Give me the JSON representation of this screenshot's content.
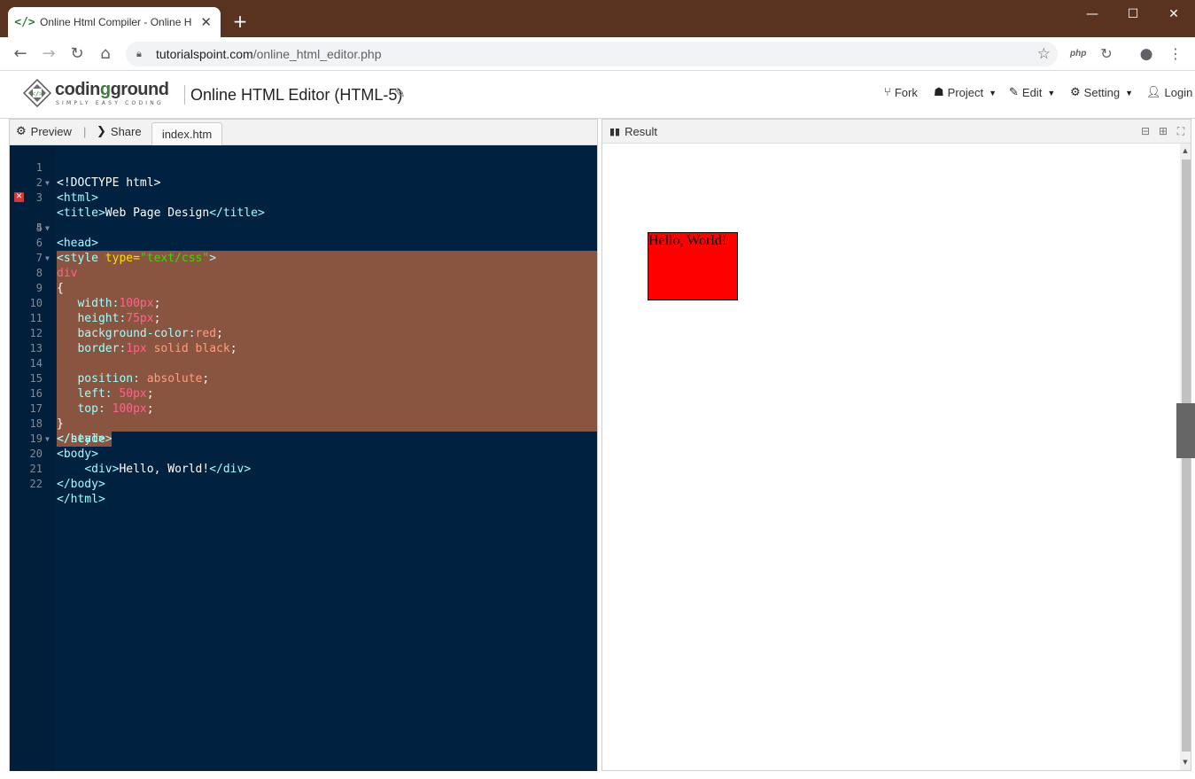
{
  "browser": {
    "tab_title": "Online Html Compiler - Online H",
    "tab_close": "✕",
    "new_tab": "+",
    "url_host": "tutorialspoint.com",
    "url_path": "/online_html_editor.php",
    "ext_php": "php",
    "win_min": "—",
    "win_max": "☐",
    "win_close": "✕"
  },
  "header": {
    "logo_main": "codin",
    "logo_green": "g",
    "logo_rest": "ground",
    "logo_tagline": "SIMPLY EASY CODING",
    "title": "Online HTML Editor (HTML-5)",
    "menu": {
      "fork": "Fork",
      "project": "Project",
      "edit": "Edit",
      "setting": "Setting",
      "login": "Login"
    }
  },
  "editor": {
    "preview_label": "Preview",
    "share_label": "Share",
    "file_tab": "index.htm",
    "line_numbers": [
      "1",
      "2",
      "3",
      "4",
      "5",
      "6",
      "7",
      "8",
      "9",
      "10",
      "11",
      "12",
      "13",
      "14",
      "15",
      "16",
      "17",
      "18",
      "19",
      "20",
      "21",
      "22"
    ]
  },
  "code": {
    "l1": "<!DOCTYPE html>",
    "l2": "<html>",
    "l3_open": "<title>",
    "l3_text": "Web Page Design",
    "l3_close": "</title>",
    "l4": "<head>",
    "l5_tag": "<style",
    "l5_attr": " type=",
    "l5_str": "\"text/css\"",
    "l5_end": ">",
    "l6": "div",
    "l7": "{",
    "l8_prop": "   width:",
    "l8_num": "100px",
    "l8_end": ";",
    "l9_prop": "   height:",
    "l9_num": "75px",
    "l9_end": ";",
    "l10_prop": "   background-color:",
    "l10_val": "red",
    "l10_end": ";",
    "l11_prop": "   border:",
    "l11_num": "1px",
    "l11_val": " solid black",
    "l11_end": ";",
    "l13_prop": "   position:",
    "l13_val": " absolute",
    "l13_end": ";",
    "l14_prop": "   left:",
    "l14_num": " 50px",
    "l14_end": ";",
    "l15_prop": "   top:",
    "l15_num": " 100px",
    "l15_end": ";",
    "l16": "}",
    "l17": "</style>",
    "l18": "</head>",
    "l19": "<body>",
    "l20_indent": "    ",
    "l20_open": "<div>",
    "l20_text": "Hello, World!",
    "l20_close": "</div>",
    "l21": "</body>",
    "l22": "</html>"
  },
  "result": {
    "label": "Result",
    "box_text": "Hello, World!"
  }
}
